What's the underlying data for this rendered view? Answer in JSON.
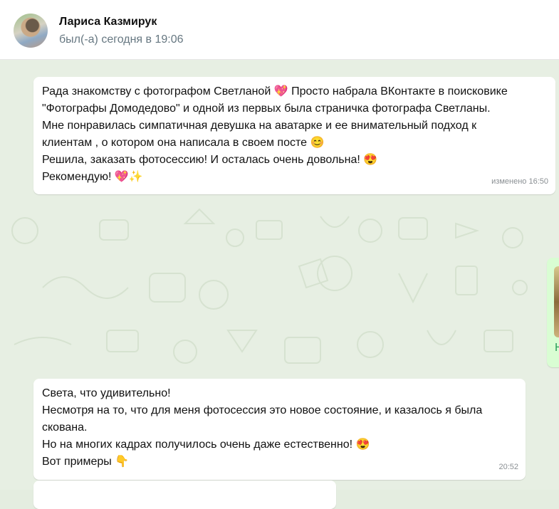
{
  "header": {
    "contact_name": "Лариса Казмирук",
    "status": "был(-а) сегодня в 19:06"
  },
  "messages": [
    {
      "lines": [
        "Рада знакомству с фотографом Светланой 💖 Просто набрала ВКонтакте в поисковике",
        "\"Фотографы Домодедово\" и одной из первых была страничка фотографа Светланы.",
        "Мне понравилась симпатичная девушка на аватарке и ее внимательный подход к",
        "клиентам , о котором она написала в своем посте 😊",
        "Решила, заказать фотосессию! И осталась очень довольна! 😍",
        "Рекомендую! 💖✨"
      ],
      "time": "изменено 16:50"
    },
    {
      "lines": [
        "Света, что удивительно!",
        "Несмотря на то, что для меня фотосессия это новое состояние, и казалось я была",
        "скована.",
        "Но на многих кадрах получилось очень даже естественно! 😍",
        "Вот примеры 👇"
      ],
      "time": "20:52"
    }
  ],
  "outgoing_media": {
    "visible_letter": "Н"
  },
  "colors": {
    "wallpaper": "#e7efe3",
    "bubble_in": "#ffffff",
    "bubble_out": "#d9fdd3",
    "time_text": "#8a8f93"
  }
}
